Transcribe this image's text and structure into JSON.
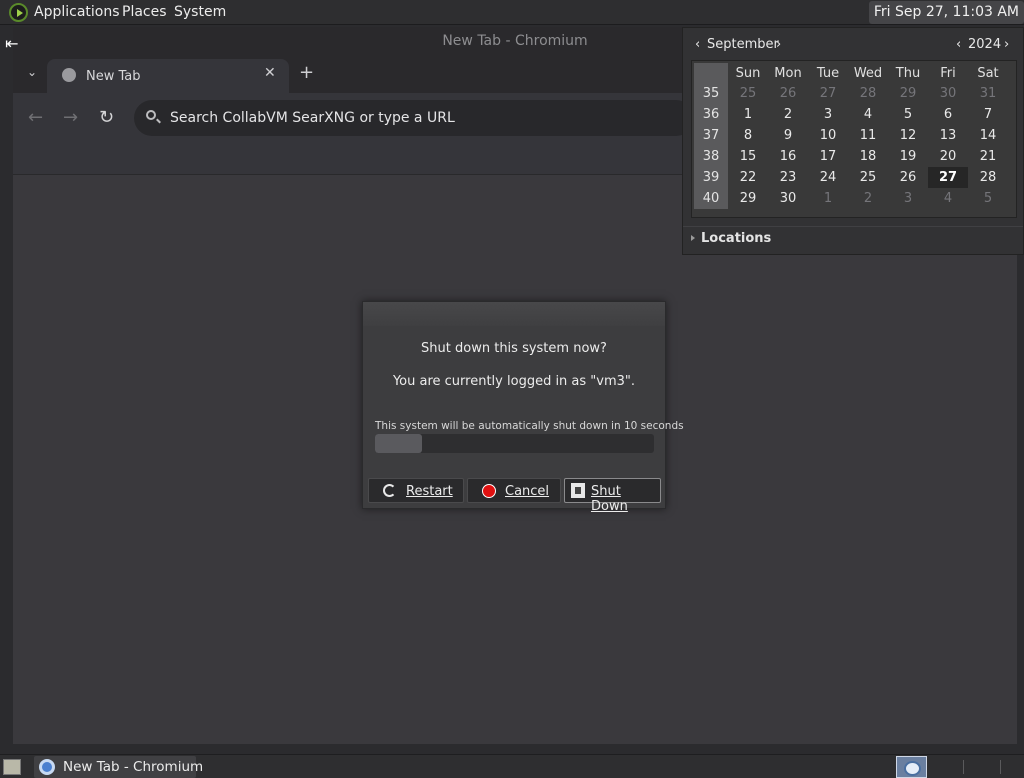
{
  "top_panel": {
    "menus": [
      "Applications",
      "Places",
      "System"
    ],
    "clock": "Fri Sep 27, 11:03 AM"
  },
  "window": {
    "title": "New Tab - Chromium",
    "tab_label": "New Tab",
    "omnibox_placeholder": "Search CollabVM SearXNG or type a URL"
  },
  "calendar": {
    "month": "September",
    "year": "2024",
    "weekdays": [
      "Sun",
      "Mon",
      "Tue",
      "Wed",
      "Thu",
      "Fri",
      "Sat"
    ],
    "weeks": [
      {
        "num": "35",
        "days": [
          "25",
          "26",
          "27",
          "28",
          "29",
          "30",
          "31"
        ]
      },
      {
        "num": "36",
        "days": [
          "1",
          "2",
          "3",
          "4",
          "5",
          "6",
          "7"
        ]
      },
      {
        "num": "37",
        "days": [
          "8",
          "9",
          "10",
          "11",
          "12",
          "13",
          "14"
        ]
      },
      {
        "num": "38",
        "days": [
          "15",
          "16",
          "17",
          "18",
          "19",
          "20",
          "21"
        ]
      },
      {
        "num": "39",
        "days": [
          "22",
          "23",
          "24",
          "25",
          "26",
          "27",
          "28"
        ]
      },
      {
        "num": "40",
        "days": [
          "29",
          "30",
          "1",
          "2",
          "3",
          "4",
          "5"
        ]
      }
    ],
    "locations_label": "Locations"
  },
  "dialog": {
    "question": "Shut down this system now?",
    "logged_in": "You are currently logged in as \"vm3\".",
    "countdown": "This system will be automatically shut down in 10 seconds",
    "progress_fraction": 0.17,
    "restart_label": "Restart",
    "cancel_label": "Cancel",
    "shutdown_label": "Shut Down"
  },
  "taskbar": {
    "task_label": "New Tab - Chromium"
  }
}
